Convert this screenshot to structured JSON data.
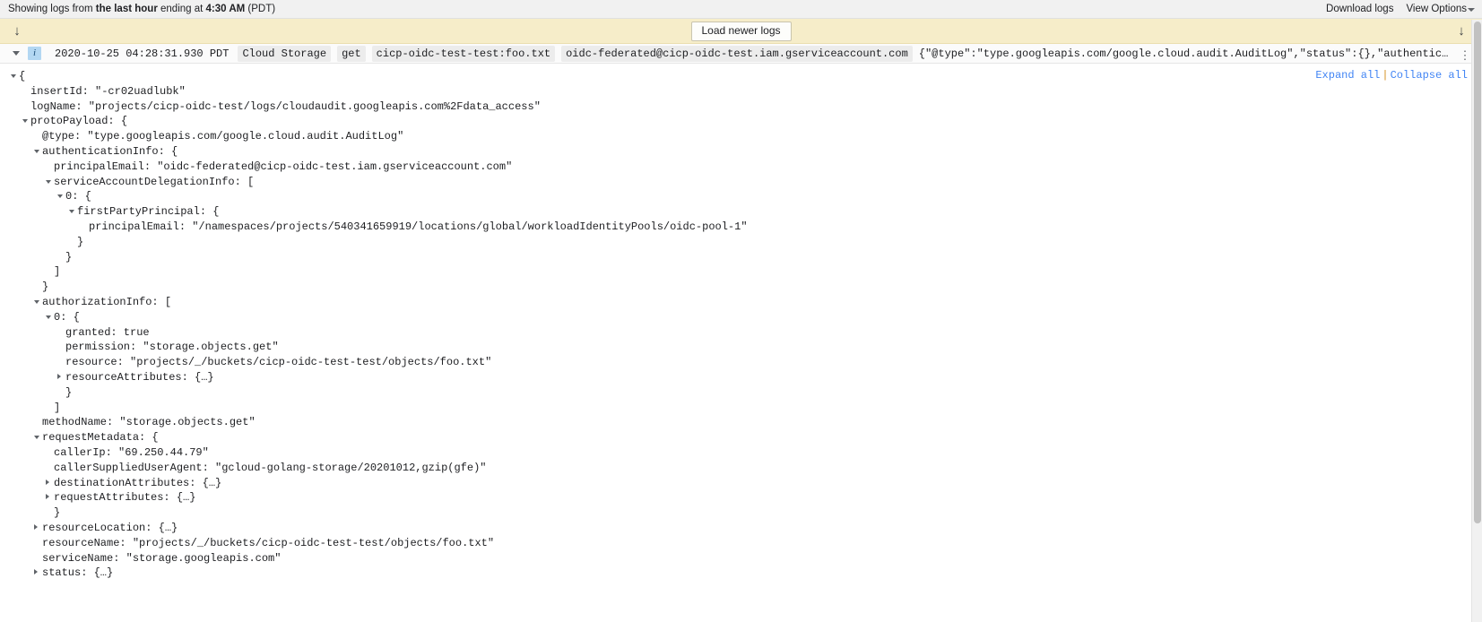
{
  "statusbar": {
    "prefix": "Showing logs from ",
    "range": "the last hour",
    "middle": " ending at ",
    "time": "4:30 AM",
    "suffix": " (PDT)",
    "download_logs": "Download logs",
    "view_options": "View Options"
  },
  "loadbar": {
    "scroll_up_arrow": "↓",
    "scroll_down_arrow": "↓",
    "load_newer_label": "Load newer logs"
  },
  "logrow": {
    "severity": "i",
    "timestamp": "2020-10-25 04:28:31.930 PDT",
    "service": "Cloud Storage",
    "method": "get",
    "resource": "cicp-oidc-test-test:foo.txt",
    "principal": "oidc-federated@cicp-oidc-test.iam.gserviceaccount.com",
    "preview": "{\"@type\":\"type.googleapis.com/google.cloud.audit.AuditLog\",\"status\":{},\"authenticationInfo\":{\"principalEmail\":\"oidc-federat…"
  },
  "detail": {
    "expand_all": "Expand all",
    "separator": "|",
    "collapse_all": "Collapse all",
    "lines": [
      {
        "indent": 0,
        "toggle": "open",
        "text": "{"
      },
      {
        "indent": 1,
        "toggle": "none",
        "text": "insertId: \"-cr02uadlubk\""
      },
      {
        "indent": 1,
        "toggle": "none",
        "text": "logName: \"projects/cicp-oidc-test/logs/cloudaudit.googleapis.com%2Fdata_access\""
      },
      {
        "indent": 1,
        "toggle": "open",
        "text": "protoPayload: {"
      },
      {
        "indent": 2,
        "toggle": "none",
        "text": "@type: \"type.googleapis.com/google.cloud.audit.AuditLog\""
      },
      {
        "indent": 2,
        "toggle": "open",
        "text": "authenticationInfo: {"
      },
      {
        "indent": 3,
        "toggle": "none",
        "text": "principalEmail: \"oidc-federated@cicp-oidc-test.iam.gserviceaccount.com\""
      },
      {
        "indent": 3,
        "toggle": "open",
        "text": "serviceAccountDelegationInfo: ["
      },
      {
        "indent": 4,
        "toggle": "open",
        "text": "0: {"
      },
      {
        "indent": 5,
        "toggle": "open",
        "text": "firstPartyPrincipal: {"
      },
      {
        "indent": 6,
        "toggle": "none",
        "text": "principalEmail: \"/namespaces/projects/540341659919/locations/global/workloadIdentityPools/oidc-pool-1\""
      },
      {
        "indent": 5,
        "toggle": "none",
        "text": "}"
      },
      {
        "indent": 4,
        "toggle": "none",
        "text": "}"
      },
      {
        "indent": 3,
        "toggle": "none",
        "text": "]"
      },
      {
        "indent": 2,
        "toggle": "none",
        "text": "}"
      },
      {
        "indent": 2,
        "toggle": "open",
        "text": "authorizationInfo: ["
      },
      {
        "indent": 3,
        "toggle": "open",
        "text": "0: {"
      },
      {
        "indent": 4,
        "toggle": "none",
        "text": "granted: true"
      },
      {
        "indent": 4,
        "toggle": "none",
        "text": "permission: \"storage.objects.get\""
      },
      {
        "indent": 4,
        "toggle": "none",
        "text": "resource: \"projects/_/buckets/cicp-oidc-test-test/objects/foo.txt\""
      },
      {
        "indent": 4,
        "toggle": "closed",
        "text": "resourceAttributes: {…}"
      },
      {
        "indent": 4,
        "toggle": "none",
        "text": "}"
      },
      {
        "indent": 3,
        "toggle": "none",
        "text": "]"
      },
      {
        "indent": 2,
        "toggle": "none",
        "text": "methodName: \"storage.objects.get\""
      },
      {
        "indent": 2,
        "toggle": "open",
        "text": "requestMetadata: {"
      },
      {
        "indent": 3,
        "toggle": "none",
        "text": "callerIp: \"69.250.44.79\""
      },
      {
        "indent": 3,
        "toggle": "none",
        "text": "callerSuppliedUserAgent: \"gcloud-golang-storage/20201012,gzip(gfe)\""
      },
      {
        "indent": 3,
        "toggle": "closed",
        "text": "destinationAttributes: {…}"
      },
      {
        "indent": 3,
        "toggle": "closed",
        "text": "requestAttributes: {…}"
      },
      {
        "indent": 3,
        "toggle": "none",
        "text": "}"
      },
      {
        "indent": 2,
        "toggle": "closed",
        "text": "resourceLocation: {…}"
      },
      {
        "indent": 2,
        "toggle": "none",
        "text": "resourceName: \"projects/_/buckets/cicp-oidc-test-test/objects/foo.txt\""
      },
      {
        "indent": 2,
        "toggle": "none",
        "text": "serviceName: \"storage.googleapis.com\""
      },
      {
        "indent": 2,
        "toggle": "closed",
        "text": "status: {…}"
      }
    ]
  },
  "colors": {
    "banner": "#f6edc9",
    "link": "#4285f4",
    "severity_badge": "#b3d7f2",
    "chip": "#ececec"
  }
}
